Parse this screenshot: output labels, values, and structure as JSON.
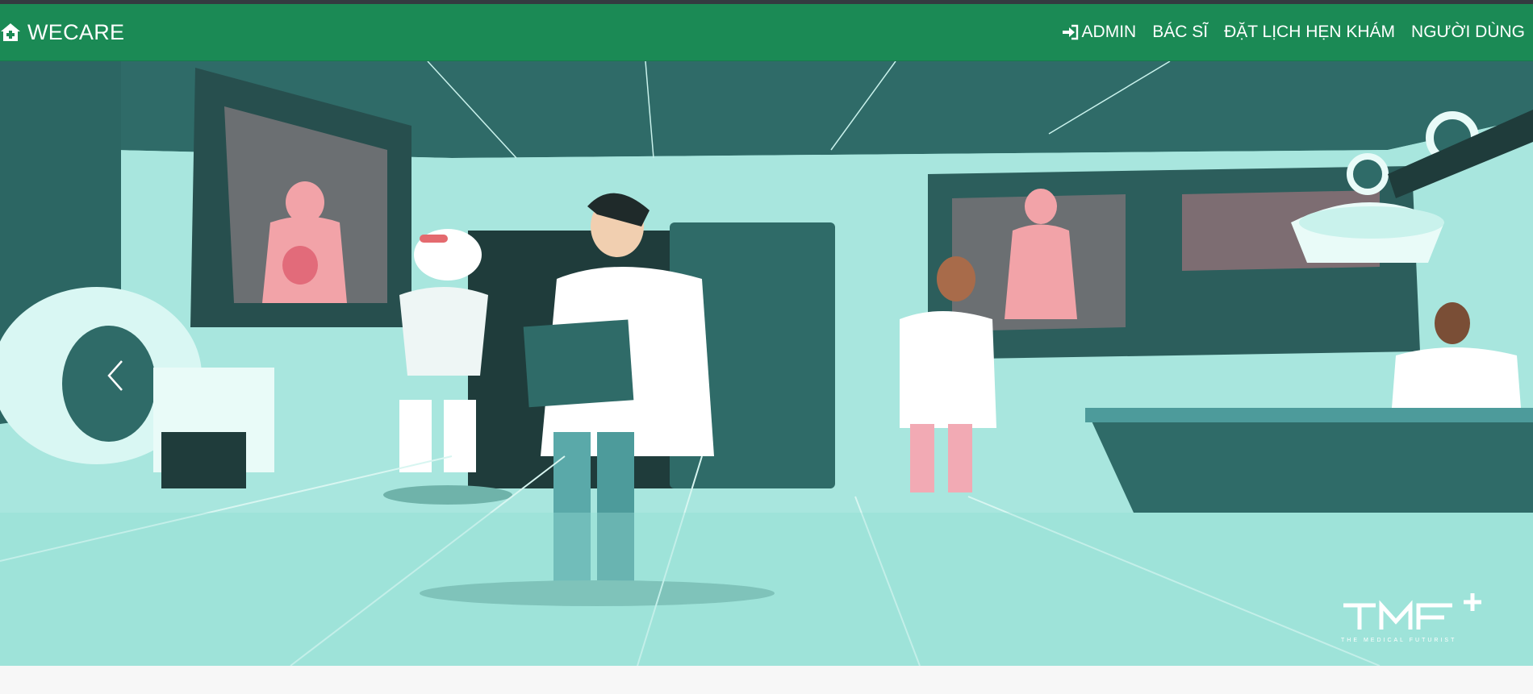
{
  "navbar": {
    "brand_label": "WECARE",
    "brand_icon": "house-medical-icon",
    "items": [
      {
        "label": "ADMIN",
        "icon": "sign-in-icon"
      },
      {
        "label": "BÁC SĨ"
      },
      {
        "label": "ĐẶT LỊCH HẸN KHÁM"
      },
      {
        "label": "NGƯỜI DÙNG"
      }
    ]
  },
  "carousel": {
    "prev_icon": "chevron-left-icon",
    "logo_text": "TMF",
    "logo_tagline": "THE MEDICAL FUTURIST"
  },
  "colors": {
    "navbar": "#1b8a55",
    "topstrip": "#343a40",
    "hero_floor": "#9fe3d9",
    "hero_dark": "#2f6b68"
  }
}
